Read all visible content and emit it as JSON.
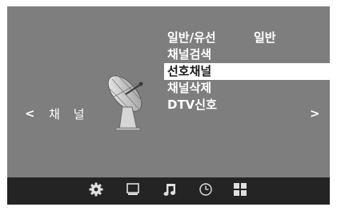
{
  "section": {
    "title": "채 널",
    "prev_arrow": "<",
    "next_arrow": ">"
  },
  "menu": {
    "items": [
      {
        "label": "일반/유선",
        "value": "일반",
        "selected": false
      },
      {
        "label": "채널검색",
        "selected": false
      },
      {
        "label": "선호채널",
        "selected": true
      },
      {
        "label": "채널삭제",
        "selected": false
      },
      {
        "label": "DTV신호",
        "selected": false
      }
    ]
  },
  "bottom_tabs": [
    {
      "icon": "gear-icon",
      "active": true
    },
    {
      "icon": "monitor-icon",
      "active": false
    },
    {
      "icon": "music-note-icon",
      "active": false
    },
    {
      "icon": "clock-icon",
      "active": false
    },
    {
      "icon": "grid-icon",
      "active": false
    }
  ],
  "colors": {
    "background": "#7e7e7e",
    "bottom_bar": "#242424",
    "selected_row": "#ffffff",
    "text": "#ffffff"
  }
}
